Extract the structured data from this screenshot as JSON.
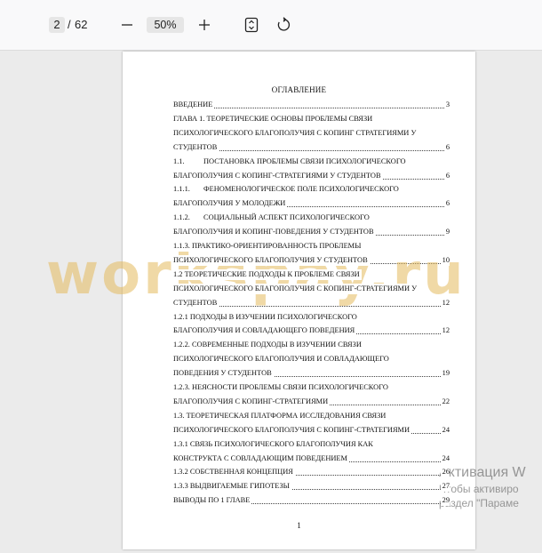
{
  "toolbar": {
    "current_page": "2",
    "page_separator": "/",
    "total_pages": "62",
    "zoom": "50%",
    "icons": [
      "minus-icon",
      "plus-icon",
      "fit-page-icon",
      "rotate-icon"
    ]
  },
  "document": {
    "toc_title": "ОГЛАВЛЕНИЕ",
    "lines": [
      {
        "text": "ВВЕДЕНИЕ",
        "page": "3"
      },
      {
        "text": "ГЛАВА 1. ТЕОРЕТИЧЕСКИЕ ОСНОВЫ ПРОБЛЕМЫ СВЯЗИ",
        "page": ""
      },
      {
        "text": "ПСИХОЛОГИЧЕСКОГО БЛАГОПОЛУЧИЯ С КОПИНГ СТРАТЕГИЯМИ У",
        "page": ""
      },
      {
        "text": "СТУДЕНТОВ",
        "page": "6"
      },
      {
        "num": "1.1.",
        "text": "ПОСТАНОВКА ПРОБЛЕМЫ СВЯЗИ ПСИХОЛОГИЧЕСКОГО",
        "page": ""
      },
      {
        "text": "БЛАГОПОЛУЧИЯ С КОПИНГ-СТРАТЕГИЯМИ У СТУДЕНТОВ",
        "page": "6"
      },
      {
        "num": "1.1.1.",
        "text": "ФЕНОМЕНОЛОГИЧЕСКОЕ ПОЛЕ ПСИХОЛОГИЧЕСКОГО",
        "page": ""
      },
      {
        "text": "БЛАГОПОЛУЧИЯ У МОЛОДЕЖИ",
        "page": "6"
      },
      {
        "num": "1.1.2.",
        "text": "СОЦИАЛЬНЫЙ АСПЕКТ ПСИХОЛОГИЧЕСКОГО",
        "page": ""
      },
      {
        "text": "БЛАГОПОЛУЧИЯ И КОПИНГ-ПОВЕДЕНИЯ У СТУДЕНТОВ",
        "page": "9"
      },
      {
        "text": "1.1.3. ПРАКТИКО-ОРИЕНТИРОВАННОСТЬ ПРОБЛЕМЫ",
        "page": ""
      },
      {
        "text": "ПСИХОЛОГИЧЕСКОГО БЛАГОПОЛУЧИЯ У СТУДЕНТОВ",
        "page": "10"
      },
      {
        "text": "1.2 ТЕОРЕТИЧЕСКИЕ ПОДХОДЫ К ПРОБЛЕМЕ СВЯЗИ",
        "page": ""
      },
      {
        "text": "ПСИХОЛОГИЧЕСКОГО БЛАГОПОЛУЧИЯ С КОПИНГ-СТРАТЕГИЯМИ У",
        "page": ""
      },
      {
        "text": "СТУДЕНТОВ",
        "page": "12"
      },
      {
        "text": "1.2.1 ПОДХОДЫ В ИЗУЧЕНИИ ПСИХОЛОГИЧЕСКОГО",
        "page": ""
      },
      {
        "text": "БЛАГОПОЛУЧИЯ И СОВЛАДАЮЩЕГО ПОВЕДЕНИЯ",
        "page": "12"
      },
      {
        "text": "1.2.2. СОВРЕМЕННЫЕ ПОДХОДЫ В ИЗУЧЕНИИ СВЯЗИ",
        "page": ""
      },
      {
        "text": "ПСИХОЛОГИЧЕСКОГО БЛАГОПОЛУЧИЯ И СОВЛАДАЮЩЕГО",
        "page": ""
      },
      {
        "text": "ПОВЕДЕНИЯ У СТУДЕНТОВ",
        "page": "19"
      },
      {
        "text": "1.2.3. НЕЯСНОСТИ ПРОБЛЕМЫ СВЯЗИ ПСИХОЛОГИЧЕСКОГО",
        "page": ""
      },
      {
        "text": "БЛАГОПОЛУЧИЯ С КОПИНГ-СТРАТЕГИЯМИ",
        "page": "22"
      },
      {
        "text": "1.3. ТЕОРЕТИЧЕСКАЯ ПЛАТФОРМА ИССЛЕДОВАНИЯ СВЯЗИ",
        "page": ""
      },
      {
        "text": "ПСИХОЛОГИЧЕСКОГО БЛАГОПОЛУЧИЯ С КОПИНГ-СТРАТЕГИЯМИ",
        "page": "24"
      },
      {
        "text": "1.3.1 СВЯЗЬ ПСИХОЛОГИЧЕСКОГО БЛАГОПОЛУЧИЯ КАК",
        "page": ""
      },
      {
        "text": "КОНСТРУКТА С СОВЛАДАЮЩИМ ПОВЕДЕНИЕМ",
        "page": "24"
      },
      {
        "text": "1.3.2 СОБСТВЕННАЯ КОНЦЕПЦИЯ",
        "page": "26"
      },
      {
        "text": "1.3.3 ВЫДВИГАЕМЫЕ ГИПОТЕЗЫ",
        "page": "27"
      },
      {
        "text": "ВЫВОДЫ ПО 1 ГЛАВЕ",
        "page": "29"
      }
    ],
    "page_number": "1"
  },
  "watermark": "workspay.ru",
  "activation": {
    "title": "Активация W",
    "line1": "Чтобы активиро",
    "line2": "раздел \"Параме"
  }
}
